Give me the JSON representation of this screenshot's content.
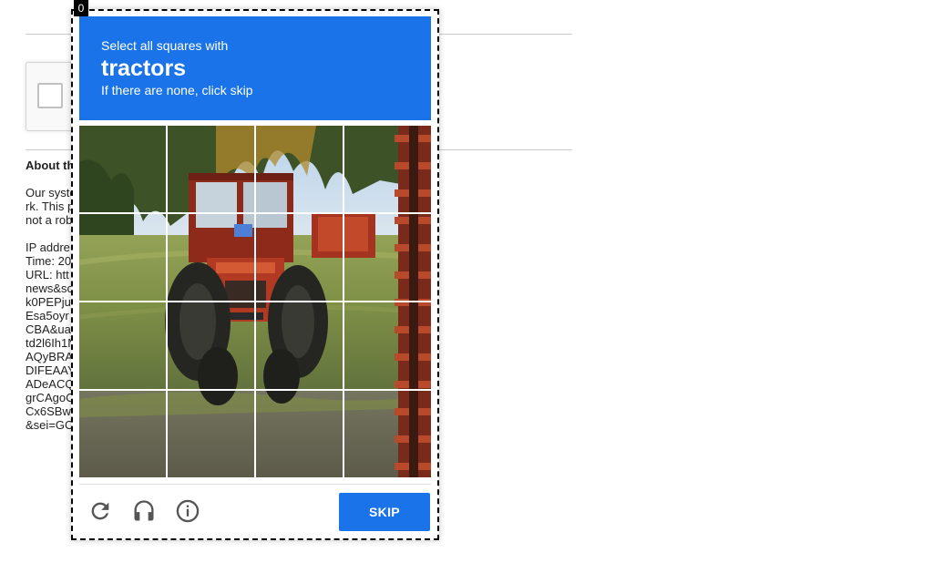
{
  "background_page": {
    "heading": "About th",
    "paragraph_lines": [
      "Our syste",
      "rk. This p",
      "not a rob"
    ],
    "info_lines": [
      "IP addre",
      "Time: 20",
      "URL: htt",
      "news&sc",
      "k0PEPju",
      "Esa5oyr",
      "CBA&ua",
      "td2l6Ih1N",
      "AQyBRA",
      "DIFEAAY",
      "ADeACQ",
      "grCAgoC",
      "Cx6SBw",
      "&sei=GC"
    ]
  },
  "frame_index": "0",
  "captcha": {
    "instruction": "Select all squares with",
    "keyword": "tractors",
    "hint": "If there are none, click skip",
    "grid_rows": 4,
    "grid_cols": 4,
    "skip_label": "SKIP",
    "colors": {
      "accent": "#1a73e8",
      "frame_border": "#000000"
    },
    "icons": [
      "reload-icon",
      "headphones-icon",
      "info-icon"
    ]
  }
}
